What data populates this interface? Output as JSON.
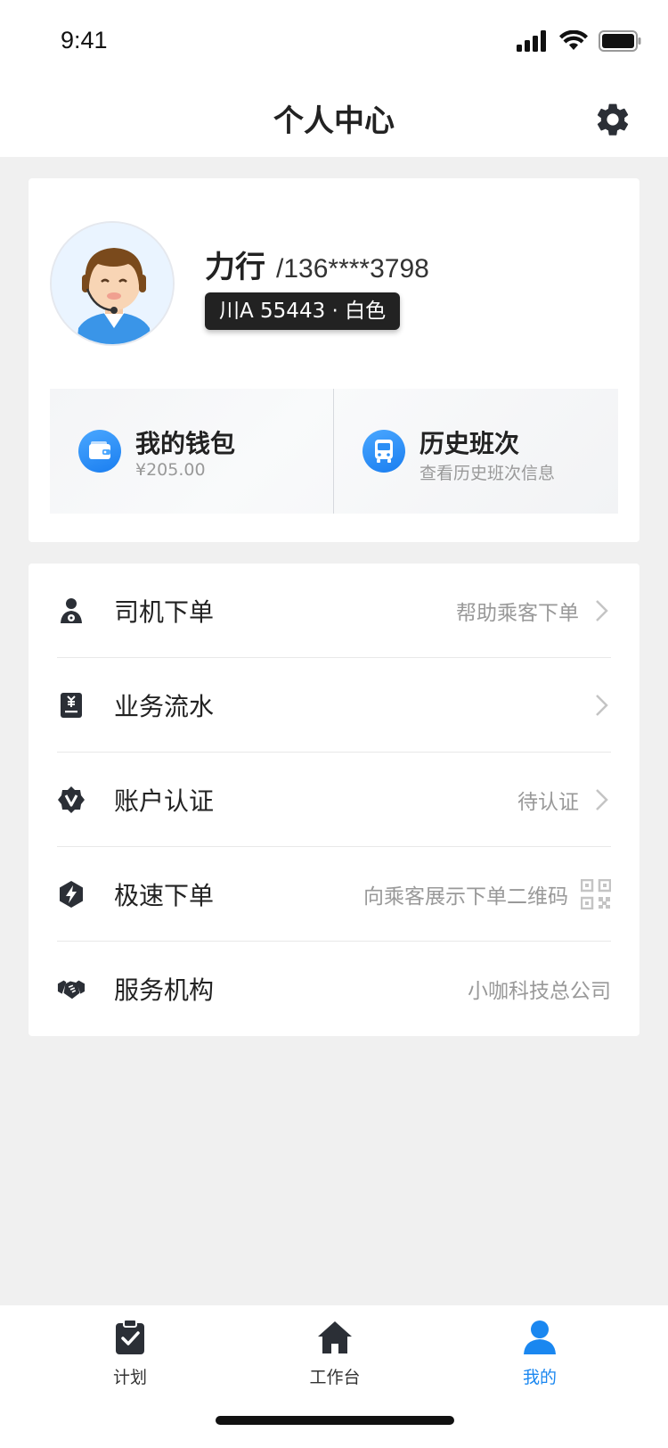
{
  "status": {
    "time": "9:41"
  },
  "header": {
    "title": "个人中心",
    "settings_icon": "gear-icon"
  },
  "profile": {
    "name": "力行",
    "phone": "/136****3798",
    "plate": "川A 55443 · 白色"
  },
  "quick": [
    {
      "title": "我的钱包",
      "sub": "¥205.00",
      "icon": "wallet-icon"
    },
    {
      "title": "历史班次",
      "sub": "查看历史班次信息",
      "icon": "bus-icon"
    }
  ],
  "menu": [
    {
      "label": "司机下单",
      "value": "帮助乘客下单",
      "icon": "driver-icon"
    },
    {
      "label": "业务流水",
      "value": "",
      "icon": "ledger-icon"
    },
    {
      "label": "账户认证",
      "value": "待认证",
      "icon": "verified-badge-icon"
    },
    {
      "label": "极速下单",
      "value": "向乘客展示下单二维码",
      "icon": "lightning-icon"
    },
    {
      "label": "服务机构",
      "value": "小咖科技总公司",
      "icon": "handshake-icon"
    }
  ],
  "tabs": [
    {
      "label": "计划",
      "icon": "clipboard-check-icon"
    },
    {
      "label": "工作台",
      "icon": "home-icon"
    },
    {
      "label": "我的",
      "icon": "user-icon"
    }
  ],
  "colors": {
    "accent": "#1a87f0",
    "bg": "#f0f0f0",
    "plate_bg": "#222222"
  }
}
